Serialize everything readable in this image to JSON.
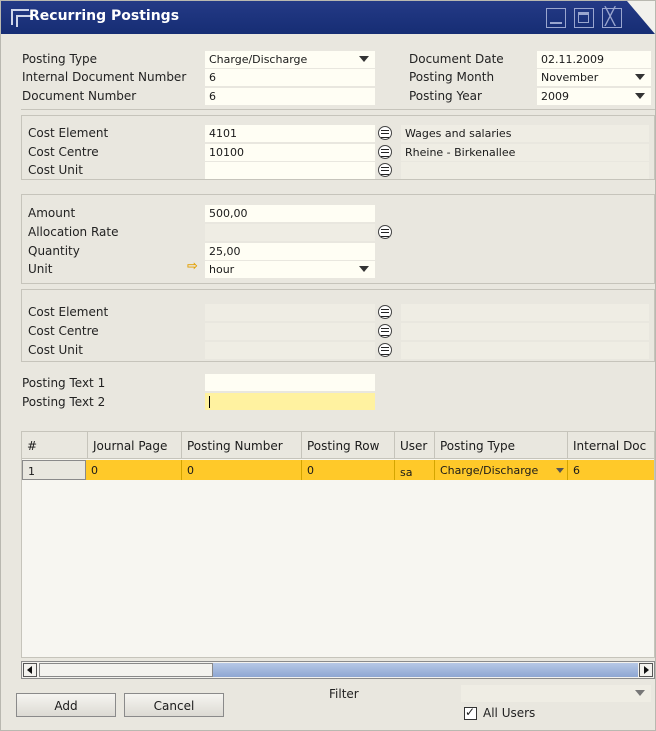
{
  "window": {
    "title": "Recurring Postings"
  },
  "header": {
    "posting_type": {
      "label": "Posting Type",
      "value": "Charge/Discharge"
    },
    "internal_document_number": {
      "label": "Internal Document Number",
      "value": "6"
    },
    "document_number": {
      "label": "Document Number",
      "value": "6"
    },
    "document_date": {
      "label": "Document Date",
      "value": "02.11.2009"
    },
    "posting_month": {
      "label": "Posting Month",
      "value": "November"
    },
    "posting_year": {
      "label": "Posting Year",
      "value": "2009"
    }
  },
  "cost_block_1": {
    "cost_element": {
      "label": "Cost Element",
      "value": "4101",
      "description": "Wages and salaries"
    },
    "cost_centre": {
      "label": "Cost Centre",
      "value": "10100",
      "description": "Rheine - Birkenallee"
    },
    "cost_unit": {
      "label": "Cost Unit",
      "value": "",
      "description": ""
    }
  },
  "amounts": {
    "amount": {
      "label": "Amount",
      "value": "500,00"
    },
    "allocation_rate": {
      "label": "Allocation Rate",
      "value": ""
    },
    "quantity": {
      "label": "Quantity",
      "value": "25,00"
    },
    "unit": {
      "label": "Unit",
      "value": "hour"
    }
  },
  "cost_block_2": {
    "cost_element": {
      "label": "Cost Element",
      "value": "",
      "description": ""
    },
    "cost_centre": {
      "label": "Cost Centre",
      "value": "",
      "description": ""
    },
    "cost_unit": {
      "label": "Cost Unit",
      "value": "",
      "description": ""
    }
  },
  "texts": {
    "posting_text_1": {
      "label": "Posting Text 1",
      "value": ""
    },
    "posting_text_2": {
      "label": "Posting Text 2",
      "value": ""
    }
  },
  "grid": {
    "columns": [
      "#",
      "Journal Page",
      "Posting Number",
      "Posting Row",
      "User",
      "Posting Type",
      "Internal  Doc"
    ],
    "rows": [
      [
        "1",
        "0",
        "0",
        "0",
        "sa",
        "Charge/Discharge",
        "6"
      ]
    ]
  },
  "footer": {
    "add_label": "Add",
    "cancel_label": "Cancel",
    "filter_label": "Filter",
    "filter_value": "",
    "all_users_label": "All Users",
    "all_users_checked": true
  },
  "colors": {
    "title_bar": "#1c337c",
    "selected_row": "#ffc929",
    "active_field": "#fff2a0"
  }
}
